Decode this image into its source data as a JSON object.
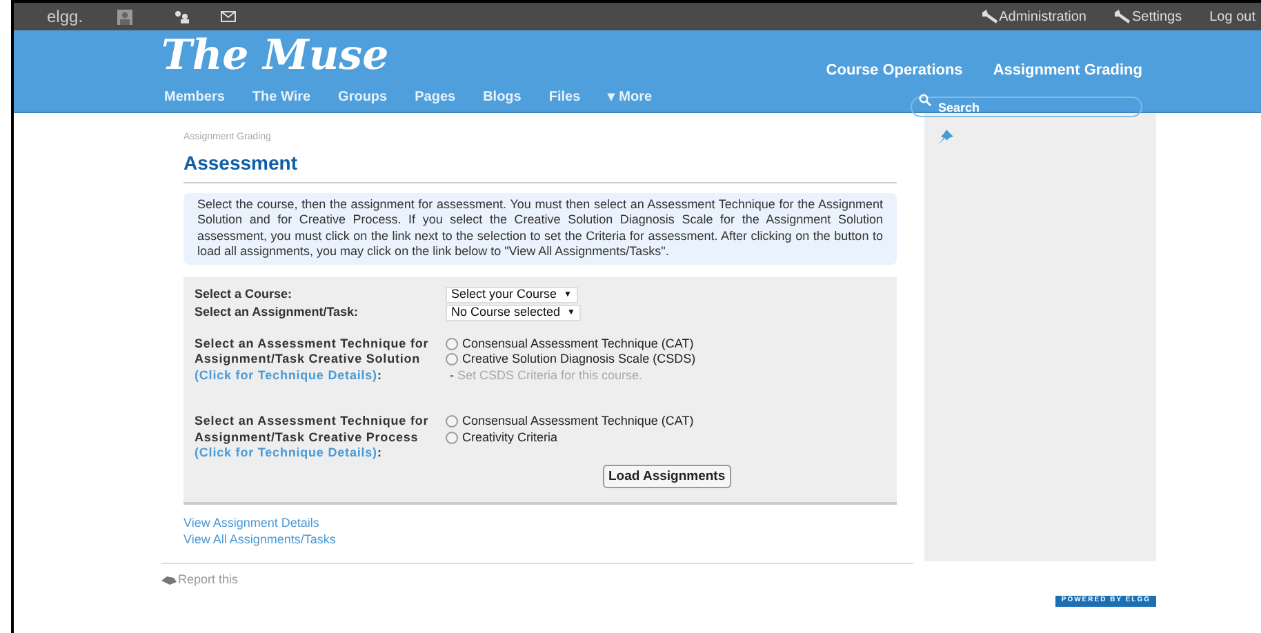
{
  "topbar": {
    "logo": "elgg.",
    "right_links": [
      "Administration",
      "Settings",
      "Log out"
    ]
  },
  "header": {
    "site_title": "The Muse",
    "header_links": [
      "Course Operations",
      "Assignment Grading"
    ],
    "search": {
      "placeholder": "Search"
    },
    "nav": [
      {
        "label": "Members",
        "kind": "link"
      },
      {
        "label": "The Wire",
        "kind": "link"
      },
      {
        "label": "Groups",
        "kind": "link"
      },
      {
        "label": "Pages",
        "kind": "link"
      },
      {
        "label": "Blogs",
        "kind": "link"
      },
      {
        "label": "Files",
        "kind": "link"
      },
      {
        "label": "More",
        "kind": "menu",
        "icon": "▾"
      }
    ]
  },
  "breadcrumb": "Assignment Grading",
  "title": "Assessment",
  "info": "Select the course, then the assignment for assessment. You must then select an Assessment Technique for the Assignment Solution and for Creative Process. If you select the Creative Solution Diagnosis Scale for the Assignment Solution assessment, you must click on the link next to the selection to set the Criteria for assessment. After clicking on the button to load all assignments, you may click on the link below to \"View All Assignments/Tasks\".",
  "selects": [
    {
      "label": "Select a Course:",
      "value": "Select your Course",
      "arrow": "▼"
    },
    {
      "label": "Select an Assignment/Task:",
      "value": "No Course selected",
      "arrow": "▼"
    }
  ],
  "techniques": [
    {
      "label": "Select an Assessment Technique for Assignment/Task Creative Solution",
      "link": "(Click for Technique Details)",
      "suffix": ":",
      "options": [
        {
          "label": "Consensual Assessment Technique (CAT)",
          "selected": false
        },
        {
          "label": "Creative Solution Diagnosis Scale (CSDS)",
          "selected": false,
          "separator": "-",
          "note": "Set CSDS Criteria for this course."
        }
      ]
    },
    {
      "label": "Select an Assessment Technique for Assignment/Task Creative Process",
      "link": "(Click for Technique Details)",
      "suffix": ":",
      "options": [
        {
          "label": "Consensual Assessment Technique (CAT)",
          "selected": false
        },
        {
          "label": "Creativity Criteria",
          "selected": false
        }
      ]
    }
  ],
  "load_button": "Load Assignments",
  "links": [
    "View Assignment Details",
    "View All Assignments/Tasks"
  ],
  "report": "Report this",
  "badge": "POWERED BY ELGG"
}
